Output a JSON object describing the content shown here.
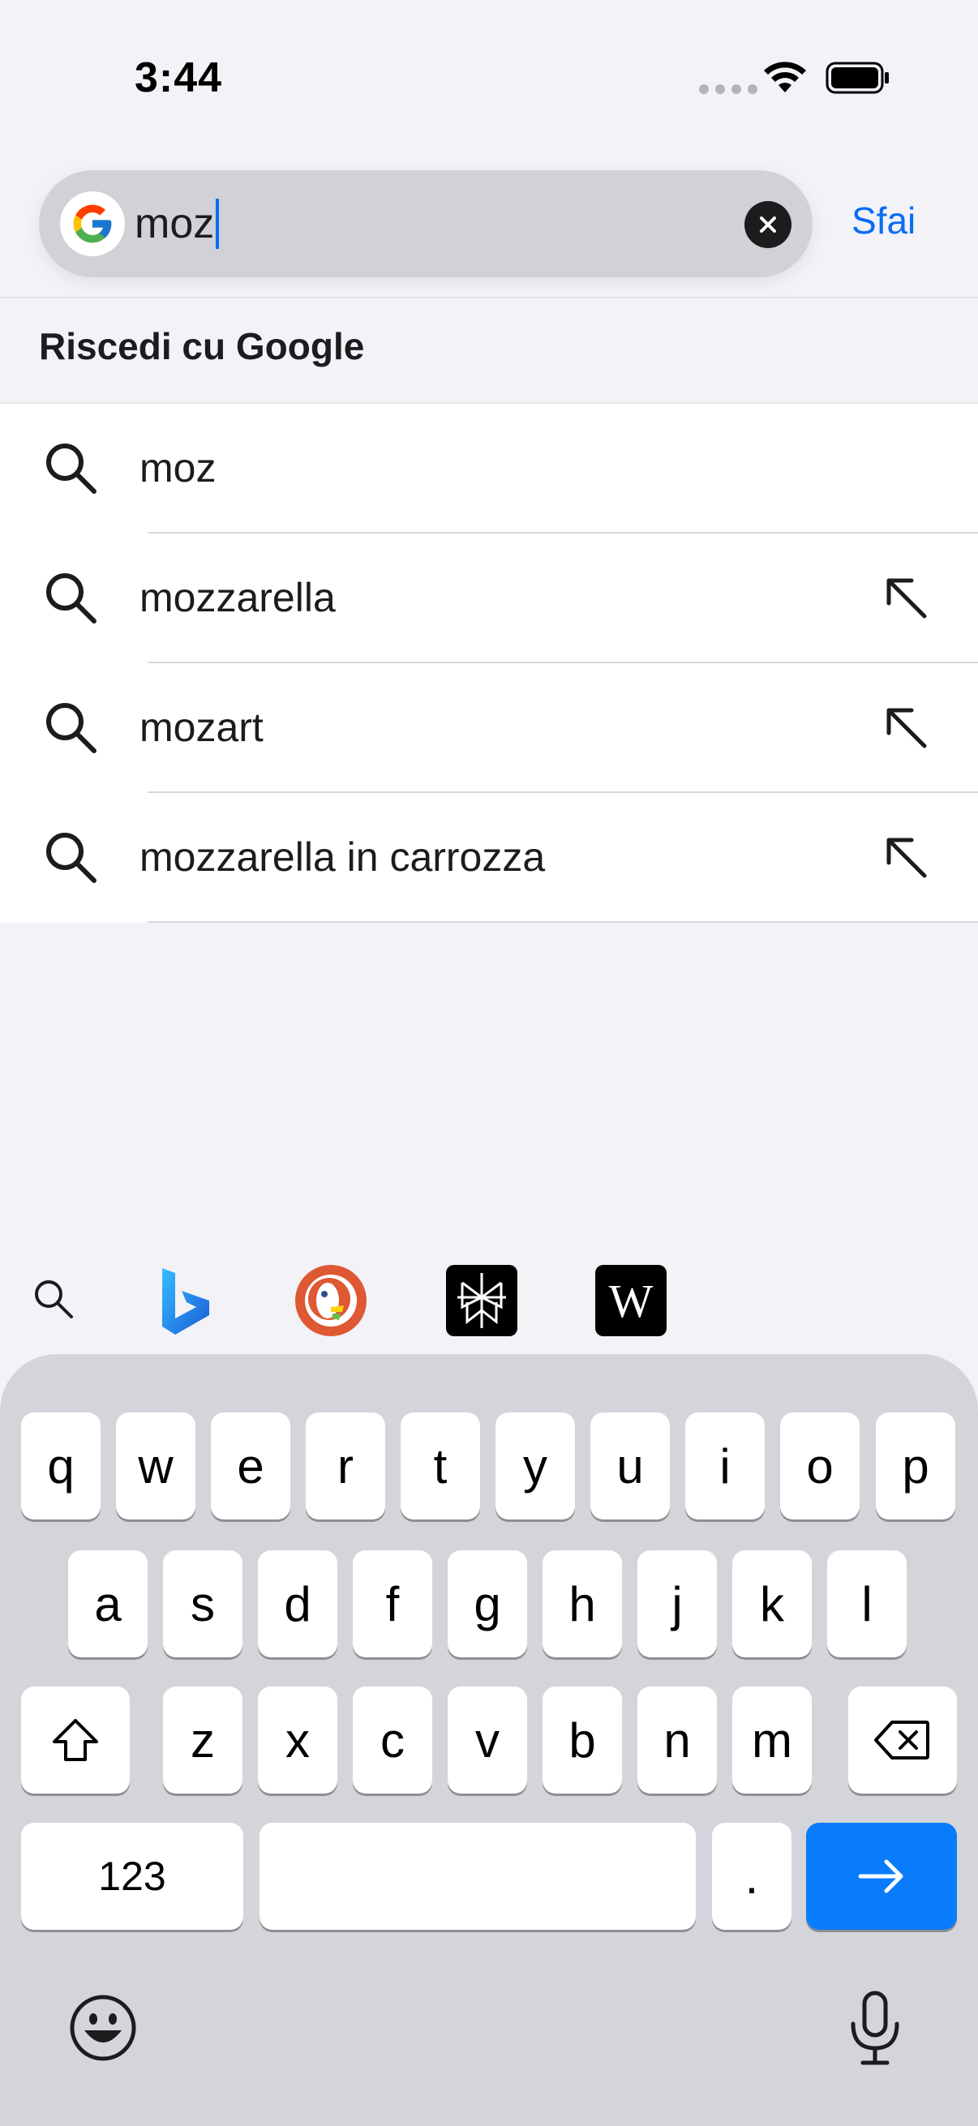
{
  "status_bar": {
    "time": "3:44"
  },
  "search": {
    "query": "moz",
    "cancel_label": "Sfai"
  },
  "suggestions": {
    "header": "Riscedi cu Google",
    "items": [
      {
        "text": "moz",
        "has_arrow": false
      },
      {
        "text": "mozzarella",
        "has_arrow": true
      },
      {
        "text": "mozart",
        "has_arrow": true
      },
      {
        "text": "mozzarella in carrozza",
        "has_arrow": true
      }
    ]
  },
  "engines": [
    "search-icon",
    "bing-icon",
    "duckduckgo-icon",
    "perplexity-icon",
    "wikipedia-icon"
  ],
  "keyboard": {
    "row1": [
      "q",
      "w",
      "e",
      "r",
      "t",
      "y",
      "u",
      "i",
      "o",
      "p"
    ],
    "row2": [
      "a",
      "s",
      "d",
      "f",
      "g",
      "h",
      "j",
      "k",
      "l"
    ],
    "row3": [
      "z",
      "x",
      "c",
      "v",
      "b",
      "n",
      "m"
    ],
    "numbers_label": "123",
    "period_label": ".",
    "wiki_label": "W"
  },
  "colors": {
    "accent": "#0a6cf4",
    "go_key": "#0a7cfb",
    "background": "#f2f2f7"
  }
}
